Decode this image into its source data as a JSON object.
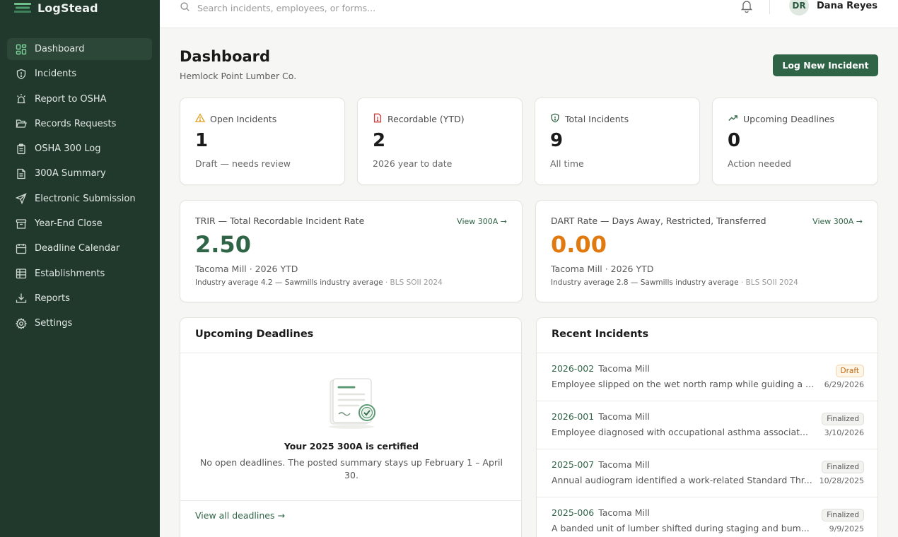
{
  "app": {
    "name": "LogStead"
  },
  "search": {
    "placeholder": "Search incidents, employees, or forms..."
  },
  "user": {
    "initials": "DR",
    "name": "Dana Reyes"
  },
  "sidebar": {
    "items": [
      {
        "label": "Dashboard",
        "icon": "dashboard-icon",
        "active": true
      },
      {
        "label": "Incidents",
        "icon": "alert-shield-icon"
      },
      {
        "label": "Report to OSHA",
        "icon": "siren-icon"
      },
      {
        "label": "Records Requests",
        "icon": "folder-open-icon"
      },
      {
        "label": "OSHA 300 Log",
        "icon": "clipboard-icon"
      },
      {
        "label": "300A Summary",
        "icon": "file-text-icon"
      },
      {
        "label": "Electronic Submission",
        "icon": "send-icon"
      },
      {
        "label": "Year-End Close",
        "icon": "archive-icon"
      },
      {
        "label": "Deadline Calendar",
        "icon": "calendar-icon"
      },
      {
        "label": "Establishments",
        "icon": "building-icon"
      },
      {
        "label": "Reports",
        "icon": "download-icon"
      },
      {
        "label": "Settings",
        "icon": "gear-icon"
      }
    ]
  },
  "header": {
    "title": "Dashboard",
    "subtitle": "Hemlock Point Lumber Co.",
    "primary_action": "Log New Incident"
  },
  "stats": [
    {
      "label": "Open Incidents",
      "value": "1",
      "note": "Draft — needs review",
      "icon": "warning-triangle-icon",
      "color": "#e0a020"
    },
    {
      "label": "Recordable (YTD)",
      "value": "2",
      "note": "2026 year to date",
      "icon": "file-alert-icon",
      "color": "#d23a3a"
    },
    {
      "label": "Total Incidents",
      "value": "9",
      "note": "All time",
      "icon": "shield-icon",
      "color": "#2f6446"
    },
    {
      "label": "Upcoming Deadlines",
      "value": "0",
      "note": "Action needed",
      "icon": "trend-up-icon",
      "color": "#2f6446"
    }
  ],
  "rates": [
    {
      "title": "TRIR — Total Recordable Incident Rate",
      "link": "View 300A →",
      "value": "2.50",
      "color": "#2f6446",
      "sub": "Tacoma Mill · 2026 YTD",
      "benchmark": "Industry average 4.2 — Sawmills industry average",
      "source": " · BLS SOII 2024"
    },
    {
      "title": "DART Rate — Days Away, Restricted, Transferred",
      "link": "View 300A →",
      "value": "0.00",
      "color": "#e07a10",
      "sub": "Tacoma Mill · 2026 YTD",
      "benchmark": "Industry average 2.8 — Sawmills industry average",
      "source": " · BLS SOII 2024"
    }
  ],
  "deadlines": {
    "title": "Upcoming Deadlines",
    "empty_title": "Your 2025 300A is certified",
    "empty_text": "No open deadlines. The posted summary stays up February 1 – April 30.",
    "view_all": "View all deadlines →"
  },
  "recent": {
    "title": "Recent Incidents",
    "items": [
      {
        "id": "2026-002",
        "site": "Tacoma Mill",
        "desc": "Employee slipped on the wet north ramp while guiding a l...",
        "status": "Draft",
        "date": "6/29/2026"
      },
      {
        "id": "2026-001",
        "site": "Tacoma Mill",
        "desc": "Employee diagnosed with occupational asthma associat...",
        "status": "Finalized",
        "date": "3/10/2026"
      },
      {
        "id": "2025-007",
        "site": "Tacoma Mill",
        "desc": "Annual audiogram identified a work-related Standard Thr...",
        "status": "Finalized",
        "date": "10/28/2025"
      },
      {
        "id": "2025-006",
        "site": "Tacoma Mill",
        "desc": "A banded unit of lumber shifted during staging and bum...",
        "status": "Finalized",
        "date": "9/9/2025"
      }
    ]
  }
}
